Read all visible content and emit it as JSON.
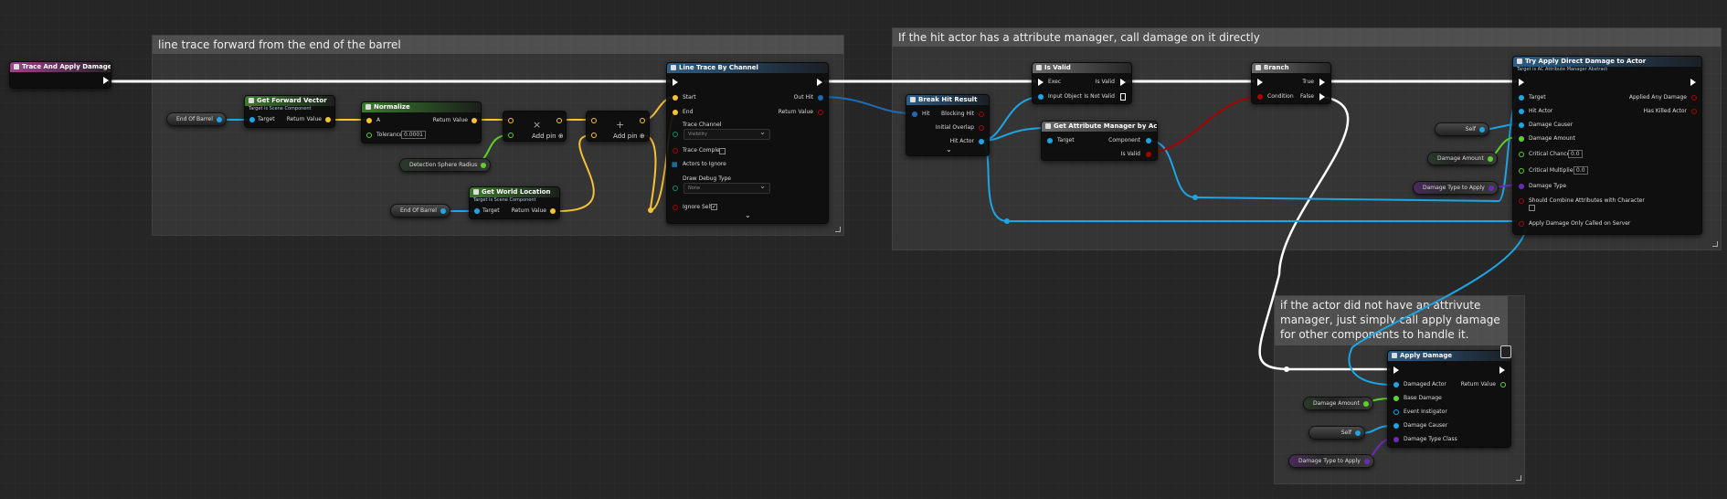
{
  "comments": {
    "trace": "line trace forward from the end of the barrel",
    "attribute": "If the hit actor has a attribute manager, call damage on it directly",
    "fallback": "if the actor did not have an attrivute manager, just simply call apply damage for other components to handle it."
  },
  "event": {
    "title": "Trace And Apply Damage"
  },
  "vars": {
    "end_of_barrel_1": "End Of Barrel",
    "end_of_barrel_2": "End Of Barrel",
    "detection_radius": "Detection Sphere Radius",
    "damage_amount_1": "Damage Amount",
    "damage_type_1": "Damage Type to Apply",
    "self_1": "Self",
    "damage_amount_2": "Damage Amount",
    "self_2": "Self",
    "damage_type_2": "Damage Type to Apply"
  },
  "get_forward": {
    "title": "Get Forward Vector",
    "subtitle": "Target is Scene Component",
    "target": "Target",
    "ret": "Return Value"
  },
  "normalize": {
    "title": "Normalize",
    "a": "A",
    "tolerance": "Tolerance",
    "tolerance_value": "0.0001",
    "ret": "Return Value"
  },
  "get_world": {
    "title": "Get World Location",
    "subtitle": "Target is Scene Component",
    "target": "Target",
    "ret": "Return Value"
  },
  "multiply": {
    "symbol": "×",
    "add_pin": "Add pin"
  },
  "add": {
    "symbol": "+",
    "add_pin": "Add pin"
  },
  "line_trace": {
    "title": "Line Trace By Channel",
    "start": "Start",
    "end": "End",
    "out_hit": "Out Hit",
    "ret": "Return Value",
    "trace_channel": "Trace Channel",
    "trace_channel_value": "Visibility",
    "trace_complex": "Trace Complex",
    "actors_to_ignore": "Actors to Ignore",
    "draw_debug": "Draw Debug Type",
    "draw_debug_value": "None",
    "ignore_self": "Ignore Self",
    "expand": "⌄"
  },
  "break_hit": {
    "title": "Break Hit Result",
    "hit": "Hit",
    "blocking_hit": "Blocking Hit",
    "initial_overlap": "Initial Overlap",
    "hit_actor": "Hit Actor",
    "expand": "⌄"
  },
  "is_valid": {
    "title": "Is Valid",
    "exec": "Exec",
    "input_object": "Input Object",
    "is_valid": "Is Valid",
    "is_not_valid": "Is Not Valid"
  },
  "get_attr": {
    "title": "Get Attribute Manager by Actor",
    "target": "Target",
    "component": "Component",
    "is_valid": "Is Valid"
  },
  "branch": {
    "title": "Branch",
    "condition": "Condition",
    "true": "True",
    "false": "False"
  },
  "try_apply": {
    "title": "Try Apply Direct Damage to Actor",
    "subtitle": "Target is AC Attribute Manager Abstract",
    "target": "Target",
    "hit_actor": "Hit Actor",
    "damage_causer": "Damage Causer",
    "damage_amount": "Damage Amount",
    "critical_chance": "Critical Chance",
    "critical_chance_value": "0.0",
    "critical_multiplier": "Critical Multiplier",
    "critical_multiplier_value": "0.0",
    "damage_type": "Damage Type",
    "should_combine": "Should Combine Attributes with Character",
    "apply_server": "Apply Damage Only Called on Server",
    "applied_any": "Applied Any Damage",
    "has_killed": "Has Killed Actor"
  },
  "apply_damage": {
    "title": "Apply Damage",
    "damaged_actor": "Damaged Actor",
    "base_damage": "Base Damage",
    "event_instigator": "Event Instigator",
    "damage_causer": "Damage Causer",
    "damage_type_class": "Damage Type Class",
    "ret": "Return Value"
  },
  "colors": {
    "exec": "#ffffff",
    "vector": "#f7c236",
    "object": "#1ea5e6",
    "float": "#5ed12c",
    "bool": "#a90000",
    "struct": "#1c6cb5",
    "class": "#6c2bb3"
  }
}
